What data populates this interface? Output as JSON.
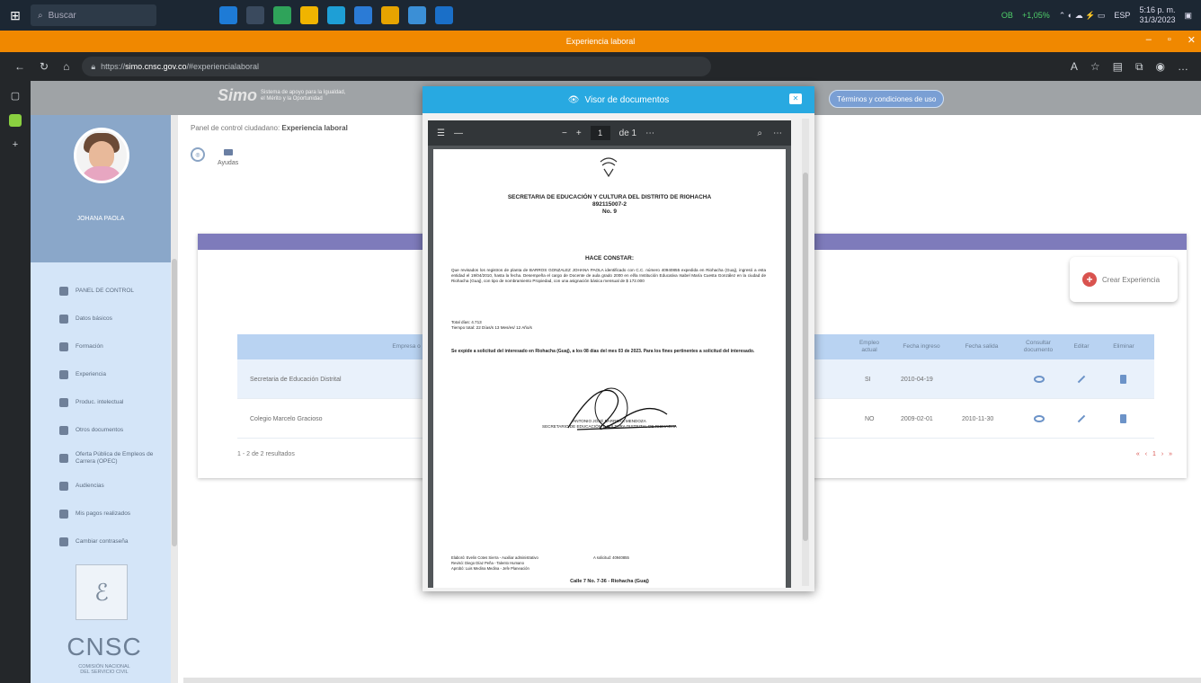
{
  "taskbar": {
    "search_placeholder": "Buscar",
    "tray_stock": "OB",
    "tray_change": "+1,05%",
    "language": "ESP",
    "time": "5:16 p. m.",
    "date": "31/3/2023"
  },
  "browser": {
    "window_title": "Experiencia laboral",
    "url_prefix": "https://",
    "url_domain": "simo.cnsc.gov.co",
    "url_path": "/#experiencialaboral"
  },
  "header": {
    "logo_mark": "Simo",
    "logo_tagline_1": "Sistema de apoyo para la Igualdad,",
    "logo_tagline_2": "el Mérito y la Oportunidad",
    "terms_link": "Términos y condiciones de uso"
  },
  "sidebar": {
    "user_name": "JOHANA PAOLA",
    "items": [
      {
        "label": "PANEL DE CONTROL"
      },
      {
        "label": "Datos básicos"
      },
      {
        "label": "Formación"
      },
      {
        "label": "Experiencia"
      },
      {
        "label": "Produc. intelectual"
      },
      {
        "label": "Otros documentos"
      },
      {
        "label": "Oferta Pública de Empleos de Carrera (OPEC)"
      },
      {
        "label": "Audiencias"
      },
      {
        "label": "Mis pagos realizados"
      },
      {
        "label": "Cambiar contraseña"
      }
    ],
    "org_acronym": "CNSC",
    "org_name_1": "COMISIÓN NACIONAL",
    "org_name_2": "DEL SERVICIO CIVIL"
  },
  "main": {
    "breadcrumb_prefix": "Panel de control ciudadano:",
    "breadcrumb_current": "Experiencia laboral",
    "help_label": "Ayudas",
    "create_button": "Crear Experiencia",
    "table": {
      "headers": {
        "company": "Empresa o Entidad",
        "current": "Empleo actual",
        "start": "Fecha ingreso",
        "end": "Fecha salida",
        "consult": "Consultar documento",
        "edit": "Editar",
        "delete": "Eliminar"
      },
      "rows": [
        {
          "company": "Secretaria de Educación Distrital",
          "current": "SI",
          "start": "2010-04-19",
          "end": ""
        },
        {
          "company": "Colegio Marcelo Gracioso",
          "current": "NO",
          "start": "2009-02-01",
          "end": "2010-11-30"
        }
      ],
      "results": "1 - 2 de 2 resultados",
      "pager": "« ‹ 1 › »"
    }
  },
  "viewer": {
    "title": "Visor de documentos",
    "page_current": "1",
    "page_total": "de 1",
    "doc": {
      "org_line_1": "SECRETARIA DE EDUCACIÓN Y CULTURA DEL DISTRITO DE RIOHACHA",
      "org_line_2": "892115007-2",
      "org_line_3": "No. 9",
      "title": "HACE CONSTAR:",
      "body": "Que revisados los registros de planta de BARROS GONZALEZ JOHANA PAOLA identificado con C.C. número 40940855 expedida en Riohacha (Guaj), ingresó a esta entidad el 19/04/2010, hasta la fecha. Desempeña el cargo de Docente de aula grado 2000 en el/la Institución Educativa Isabel María Cuesta González en la ciudad de Riohacha (Guaj), con tipo de nombramiento Propiedad, con una asignación básica mensual de $ 172.000",
      "total_line_1": "Total días: 4.713",
      "total_line_2": "Tiempo total: 22 Días/s 13 Mes/es/ 12 Año/s",
      "closing": "Se expide a solicitud del interesado en Riohacha (Guaj), a los 08 días del mes 03 de 2023. Para los fines pertinentes a solicitud del interesado.",
      "signer_name": "ANTONIO JOSÉ BARRERA MENDOZA",
      "signer_role": "SECRETARIO DE EDUCACIÓN Y CULTURA DISTRITAL DE RIOHACHA",
      "footer_1": "Elaboró: Evelin Cotes Sierra - Auxiliar administrativo",
      "footer_2": "Revisó: Diego Díaz Peña - Talento Humano",
      "footer_3": "Aprobó: Luis Medina Medina - Jefe Planeación",
      "footer_mid": "A solicitud: 40940855",
      "address": "Calle 7 No. 7-36 - Riohacha (Guaj)"
    }
  },
  "colors": {
    "accent_orange": "#f08800",
    "modal_blue": "#28a9e1",
    "panel_purple": "#7e7bbb",
    "sidebar_blue": "#d4e5f8",
    "table_header": "#b9d3f2",
    "danger": "#d9534f"
  }
}
